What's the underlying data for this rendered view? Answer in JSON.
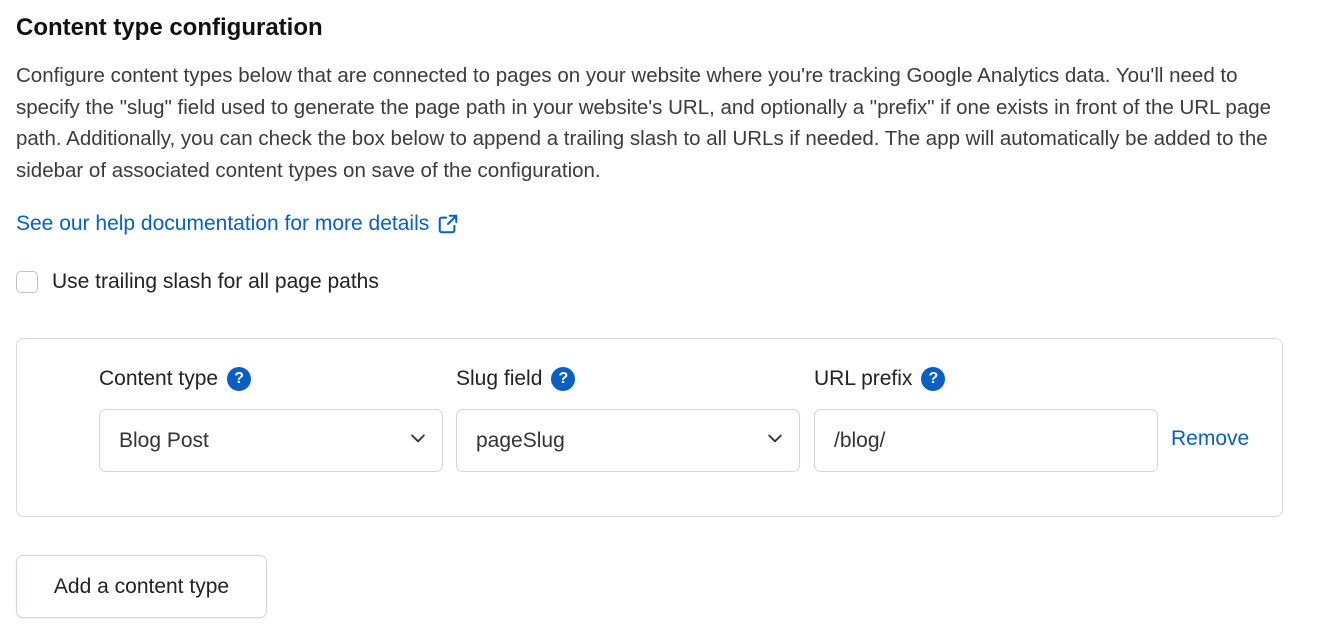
{
  "section": {
    "title": "Content type configuration",
    "description": "Configure content types below that are connected to pages on your website where you're tracking Google Analytics data. You'll need to specify the \"slug\" field used to generate the page path in your website's URL, and optionally a \"prefix\" if one exists in front of the URL page path. Additionally, you can check the box below to append a trailing slash to all URLs if needed. The app will automatically be added to the sidebar of associated content types on save of the configuration.",
    "help_link_label": "See our help documentation for more details",
    "help_link_icon": "external-link-icon"
  },
  "trailing_slash": {
    "label": "Use trailing slash for all page paths",
    "checked": false
  },
  "config_row": {
    "content_type_label": "Content type",
    "slug_field_label": "Slug field",
    "url_prefix_label": "URL prefix",
    "help_icon": "question-circle-icon",
    "help_glyph": "?",
    "content_type_value": "Blog Post",
    "slug_field_value": "pageSlug",
    "url_prefix_value": "/blog/",
    "remove_label": "Remove"
  },
  "add_button_label": "Add a content type",
  "colors": {
    "accent": "#0b5ec2",
    "text": "#1b1b1b",
    "border": "#d3d9df"
  }
}
